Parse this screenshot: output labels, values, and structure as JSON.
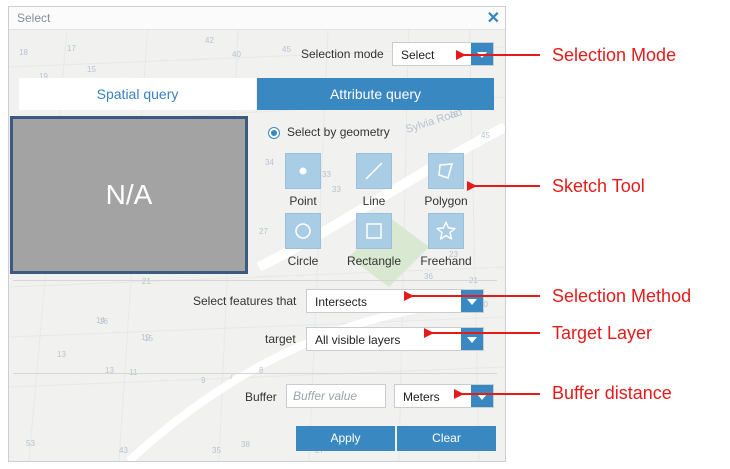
{
  "dialog": {
    "title": "Select",
    "close_icon": "close-icon"
  },
  "selection_mode": {
    "label": "Selection mode",
    "value": "Select"
  },
  "tabs": [
    {
      "label": "Spatial query",
      "active": true
    },
    {
      "label": "Attribute query",
      "active": false
    }
  ],
  "preview": {
    "text": "N/A"
  },
  "geometry": {
    "radio_label": "Select by geometry",
    "tools": [
      {
        "label": "Point",
        "icon": "point-icon"
      },
      {
        "label": "Line",
        "icon": "line-icon"
      },
      {
        "label": "Polygon",
        "icon": "polygon-icon"
      },
      {
        "label": "Circle",
        "icon": "circle-icon"
      },
      {
        "label": "Rectangle",
        "icon": "rectangle-icon"
      },
      {
        "label": "Freehand",
        "icon": "freehand-icon"
      }
    ]
  },
  "method": {
    "label": "Select features that",
    "value": "Intersects"
  },
  "target": {
    "label": "target",
    "value": "All visible layers"
  },
  "buffer": {
    "label": "Buffer",
    "placeholder": "Buffer value",
    "unit": "Meters"
  },
  "buttons": {
    "apply": "Apply",
    "clear": "Clear"
  },
  "map_labels": {
    "street": "Sylvia Road",
    "numbers": [
      "18",
      "17",
      "15",
      "42",
      "40",
      "45",
      "19",
      "15",
      "33",
      "45",
      "34",
      "33",
      "27",
      "21",
      "14",
      "19",
      "16",
      "15",
      "13",
      "13",
      "11",
      "9",
      "7",
      "8",
      "53",
      "43",
      "35",
      "38",
      "24",
      "27",
      "36",
      "23",
      "21",
      "20",
      "19"
    ]
  },
  "annotations": [
    "Selection Mode",
    "Sketch Tool",
    "Selection Method",
    "Target Layer",
    "Buffer distance"
  ],
  "colors": {
    "accent": "#3a88c2",
    "annotation": "#e31b1b",
    "preview_fill": "#a3a3a3",
    "preview_border": "#3c5a80"
  }
}
